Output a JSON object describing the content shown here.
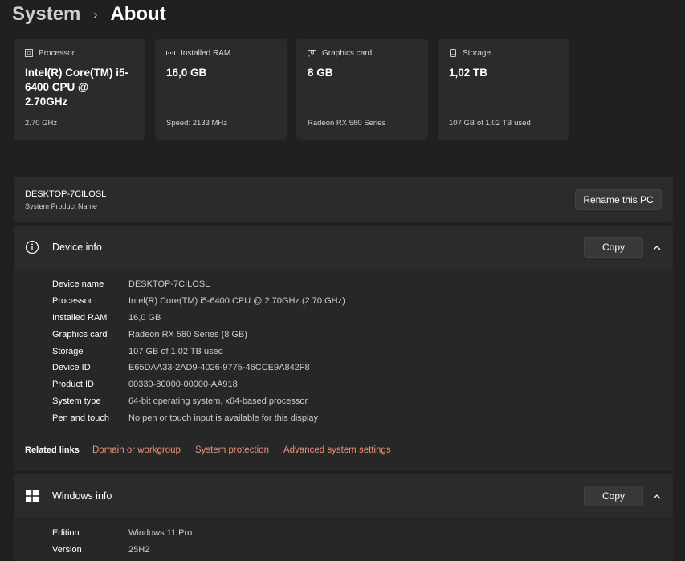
{
  "breadcrumb": {
    "parent": "System",
    "separator": "›",
    "current": "About"
  },
  "cards": [
    {
      "icon": "processor-icon",
      "label": "Processor",
      "value": "Intel(R) Core(TM) i5-6400 CPU @ 2.70GHz",
      "sub": "2.70 GHz"
    },
    {
      "icon": "ram-icon",
      "label": "Installed RAM",
      "value": "16,0 GB",
      "sub": "Speed: 2133 MHz"
    },
    {
      "icon": "graphics-card-icon",
      "label": "Graphics card",
      "value": "8 GB",
      "sub": "Radeon RX 580 Series"
    },
    {
      "icon": "storage-icon",
      "label": "Storage",
      "value": "1,02 TB",
      "sub": "107 GB of 1,02 TB used"
    }
  ],
  "pc": {
    "name": "DESKTOP-7CILOSL",
    "subtitle": "System Product Name",
    "rename_label": "Rename this PC"
  },
  "device_info": {
    "title": "Device info",
    "copy_label": "Copy",
    "rows": [
      {
        "key": "Device name",
        "value": "DESKTOP-7CILOSL"
      },
      {
        "key": "Processor",
        "value": "Intel(R) Core(TM) i5-6400 CPU @ 2.70GHz (2.70 GHz)"
      },
      {
        "key": "Installed RAM",
        "value": "16,0 GB"
      },
      {
        "key": "Graphics card",
        "value": "Radeon RX 580 Series (8 GB)"
      },
      {
        "key": "Storage",
        "value": "107 GB of 1,02 TB used"
      },
      {
        "key": "Device ID",
        "value": "E65DAA33-2AD9-4026-9775-46CCE9A842F8"
      },
      {
        "key": "Product ID",
        "value": "00330-80000-00000-AA918"
      },
      {
        "key": "System type",
        "value": "64-bit operating system, x64-based processor"
      },
      {
        "key": "Pen and touch",
        "value": "No pen or touch input is available for this display"
      }
    ]
  },
  "related": {
    "label": "Related links",
    "links": [
      "Domain or workgroup",
      "System protection",
      "Advanced system settings"
    ]
  },
  "windows_info": {
    "title": "Windows info",
    "copy_label": "Copy",
    "rows": [
      {
        "key": "Edition",
        "value": "Windows 11 Pro"
      },
      {
        "key": "Version",
        "value": "25H2"
      }
    ]
  },
  "colors": {
    "background": "#202020",
    "card": "#2b2b2b",
    "link": "#e8927a"
  }
}
